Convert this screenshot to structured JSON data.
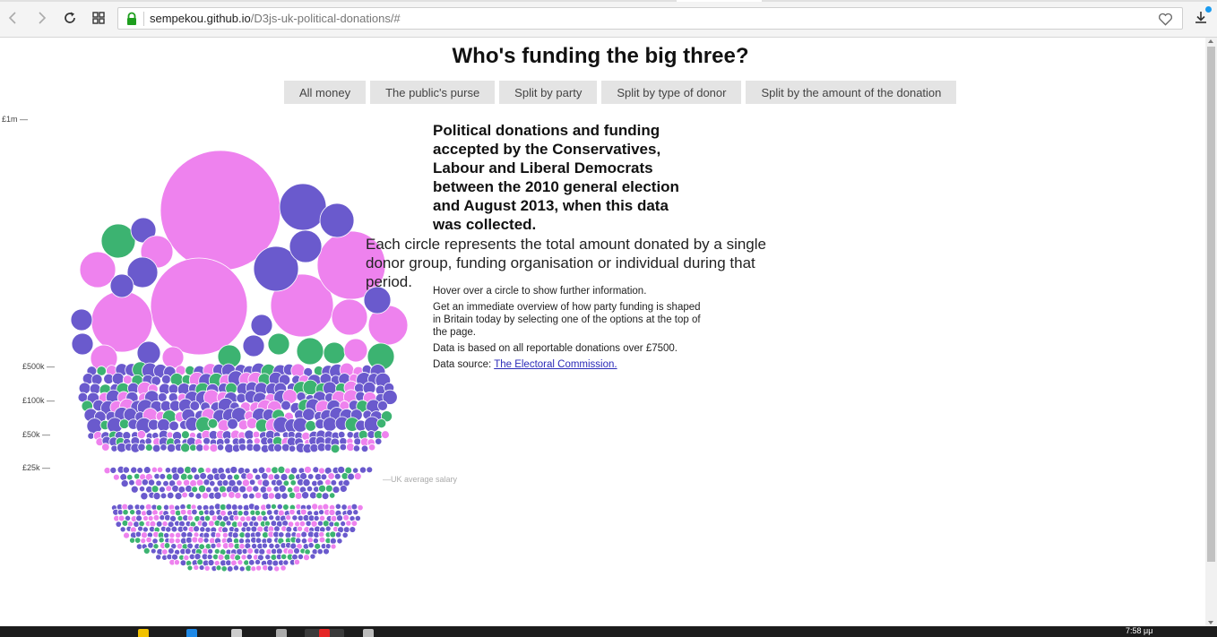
{
  "browser": {
    "url_host": "sempekou.github.io",
    "url_path": "/D3js-uk-political-donations/#"
  },
  "page": {
    "title": "Who's funding the big three?",
    "buttons": [
      "All money",
      "The public's purse",
      "Split by party",
      "Split by type of donor",
      "Split by the amount of the donation"
    ],
    "heading": "Political donations and funding accepted by the Conservatives, Labour and Liberal Democrats between the 2010 general election and August 2013, when this data was collected.",
    "subheading": "Each circle represents the total amount donated by a single donor group, funding organisation or individual during that period.",
    "hover_note": "Hover over a circle to show further information.",
    "overview_note": "Get an immediate overview of how party funding is shaped in Britain today by selecting one of the options at the top of the page.",
    "data_note": "Data is based on all reportable donations over £7500.",
    "source_prefix": "Data source: ",
    "source_link": "The Electoral Commission."
  },
  "axis": {
    "ticks": [
      "£1m —",
      "£500k —",
      "£100k —",
      "£50k —",
      "£25k —"
    ],
    "average_label": "—UK average salary"
  },
  "colors": {
    "conservative": "#6a5acd",
    "labour": "#ee82ee",
    "libdem": "#3cb371"
  },
  "taskbar": {
    "time": "7:58 μμ"
  }
}
